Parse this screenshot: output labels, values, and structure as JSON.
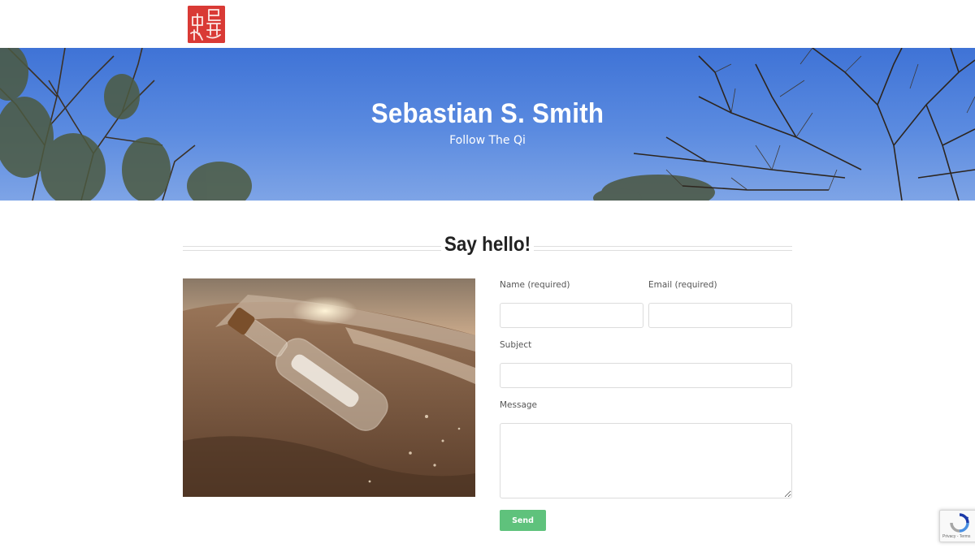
{
  "header": {
    "logo_icon": "red-seal-logo-icon",
    "logo_color": "#d93a35"
  },
  "hero": {
    "title": "Sebastian S. Smith",
    "subtitle": "Follow The Qi",
    "sky_color": "#4a7fdc"
  },
  "contact": {
    "heading": "Say hello!",
    "image_icon": "message-in-a-bottle-photo",
    "fields": {
      "name_label": "Name (required)",
      "email_label": "Email (required)",
      "subject_label": "Subject",
      "message_label": "Message",
      "name_value": "",
      "email_value": "",
      "subject_value": "",
      "message_value": ""
    },
    "send_label": "Send",
    "send_color": "#5fc27c"
  },
  "recaptcha": {
    "icon": "recaptcha-icon",
    "text": "Privacy - Terms"
  }
}
